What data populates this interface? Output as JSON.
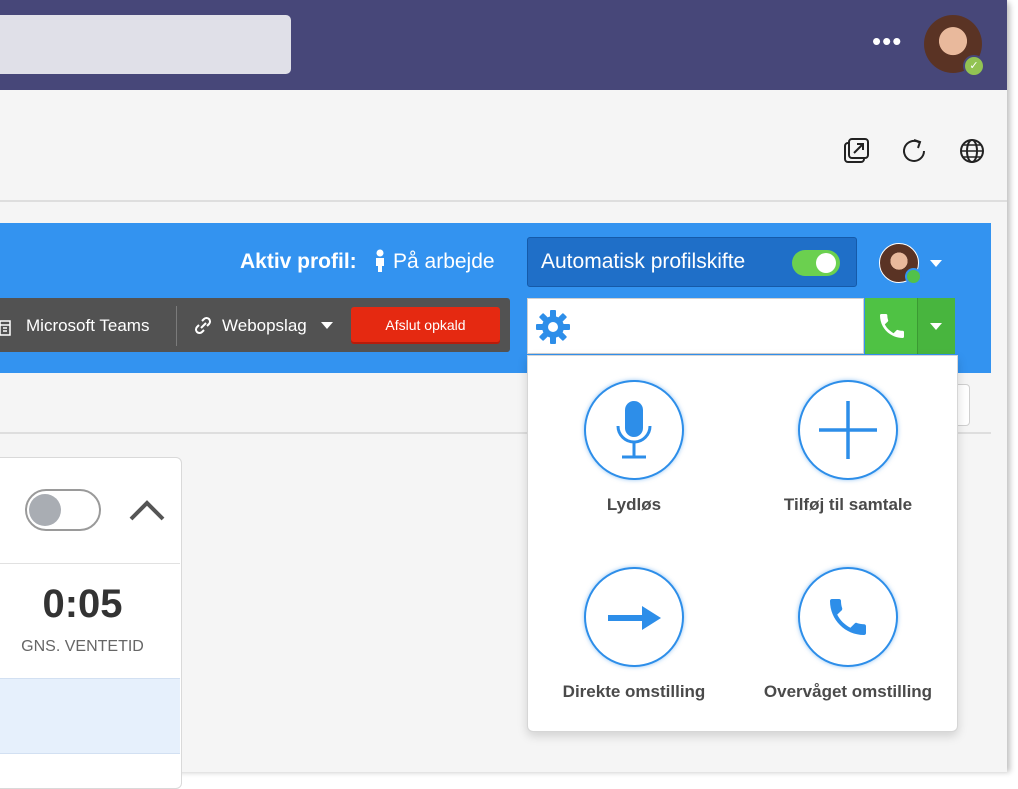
{
  "titlebar": {
    "more_label": "•••",
    "avatar_icon": "user-avatar-icon",
    "status_icon": "available-check-icon"
  },
  "toolbar": {
    "icons": [
      "popout-icon",
      "refresh-icon",
      "globe-icon"
    ]
  },
  "header": {
    "profile_label": "Aktiv profil:",
    "profile_value": "På arbejde",
    "auto_switch_label": "Automatisk profilskifte",
    "auto_switch_on": true
  },
  "actions": {
    "teams_label": "Microsoft Teams",
    "web_label": "Webopslag",
    "end_call_label": "Afslut opkald"
  },
  "dial": {
    "value": "",
    "settings_icon": "gear-icon",
    "call_icon": "phone-icon"
  },
  "popup": {
    "items": [
      {
        "label": "Lydløs",
        "icon": "microphone-icon"
      },
      {
        "label": "Tilføj til samtale",
        "icon": "plus-icon"
      },
      {
        "label": "Direkte omstilling",
        "icon": "arrow-right-icon"
      },
      {
        "label": "Overvåget omstilling",
        "icon": "phone-icon"
      }
    ]
  },
  "stats": {
    "wait_value": "0:05",
    "wait_label": "GNS. VENTETID"
  },
  "colors": {
    "brand": "#474779",
    "accent": "#3393f0",
    "call_green": "#4fc244",
    "end_red": "#e52911",
    "popup_blue": "#2d8ee9"
  }
}
